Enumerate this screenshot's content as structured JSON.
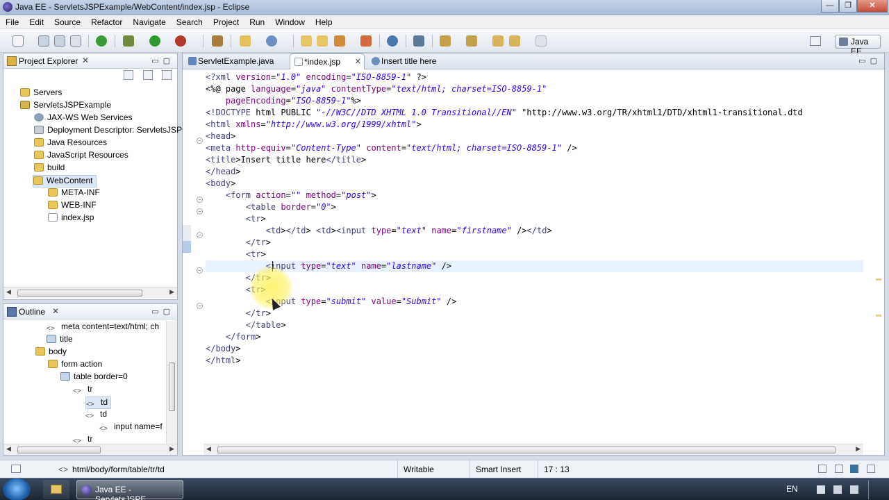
{
  "window": {
    "title": "Java EE - ServletsJSPExample/WebContent/index.jsp - Eclipse",
    "controls": [
      "—",
      "❐",
      "✕"
    ]
  },
  "menu": [
    "File",
    "Edit",
    "Source",
    "Refactor",
    "Navigate",
    "Search",
    "Project",
    "Run",
    "Window",
    "Help"
  ],
  "perspective": {
    "label": "Java EE"
  },
  "project_explorer": {
    "title": "Project Explorer",
    "items": [
      {
        "label": "Servers",
        "icon": "folder-icon"
      },
      {
        "label": "ServletsJSPExample",
        "icon": "project-icon"
      },
      {
        "label": "JAX-WS Web Services",
        "icon": "webservice-icon"
      },
      {
        "label": "Deployment Descriptor: ServletsJSP",
        "icon": "descriptor-icon"
      },
      {
        "label": "Java Resources",
        "icon": "java-resources-icon"
      },
      {
        "label": "JavaScript Resources",
        "icon": "javascript-resources-icon"
      },
      {
        "label": "build",
        "icon": "folder-icon"
      },
      {
        "label": "WebContent",
        "icon": "folder-open-icon"
      },
      {
        "label": "META-INF",
        "icon": "folder-icon"
      },
      {
        "label": "WEB-INF",
        "icon": "folder-icon"
      },
      {
        "label": "index.jsp",
        "icon": "file-icon"
      }
    ]
  },
  "outline": {
    "title": "Outline",
    "items": [
      {
        "label": "meta content=text/html; ch"
      },
      {
        "label": "title"
      },
      {
        "label": "body"
      },
      {
        "label": "form action"
      },
      {
        "label": "table border=0"
      },
      {
        "label": "tr"
      },
      {
        "label": "td"
      },
      {
        "label": "td"
      },
      {
        "label": "input name=f"
      },
      {
        "label": "tr"
      }
    ]
  },
  "editor": {
    "tabs": [
      {
        "label": "ServletExample.java",
        "active": false
      },
      {
        "label": "*index.jsp",
        "active": true
      },
      {
        "label": "Insert title here",
        "active": false
      }
    ],
    "lines": [
      "<?xml version=\"1.0\" encoding=\"ISO-8859-1\" ?>",
      "<%@ page language=\"java\" contentType=\"text/html; charset=ISO-8859-1\"",
      "    pageEncoding=\"ISO-8859-1\"%>",
      "<!DOCTYPE html PUBLIC \"-//W3C//DTD XHTML 1.0 Transitional//EN\" \"http://www.w3.org/TR/xhtml1/DTD/xhtml1-transitional.dtd",
      "<html xmlns=\"http://www.w3.org/1999/xhtml\">",
      "<head>",
      "<meta http-equiv=\"Content-Type\" content=\"text/html; charset=ISO-8859-1\" />",
      "<title>Insert title here</title>",
      "</head>",
      "<body>",
      "    <form action=\"\" method=\"post\">",
      "        <table border=\"0\">",
      "        <tr>",
      "            <td></td> <td><input type=\"text\" name=\"firstname\" /></td>",
      "        </tr>",
      "        <tr>",
      "            <input type=\"text\" name=\"lastname\" />",
      "        </tr>",
      "        <tr>",
      "            <input type=\"submit\" value=\"Submit\" />",
      "        </tr>",
      "        </table>",
      "    </form>",
      "</body>",
      "</html>"
    ]
  },
  "status": {
    "breadcrumb": "html/body/form/table/tr/td",
    "writable": "Writable",
    "insert_mode": "Smart Insert",
    "position": "17 : 13"
  },
  "taskbar": {
    "eclipse_label": "Java EE - ServletsJSPE...",
    "language": "EN"
  }
}
